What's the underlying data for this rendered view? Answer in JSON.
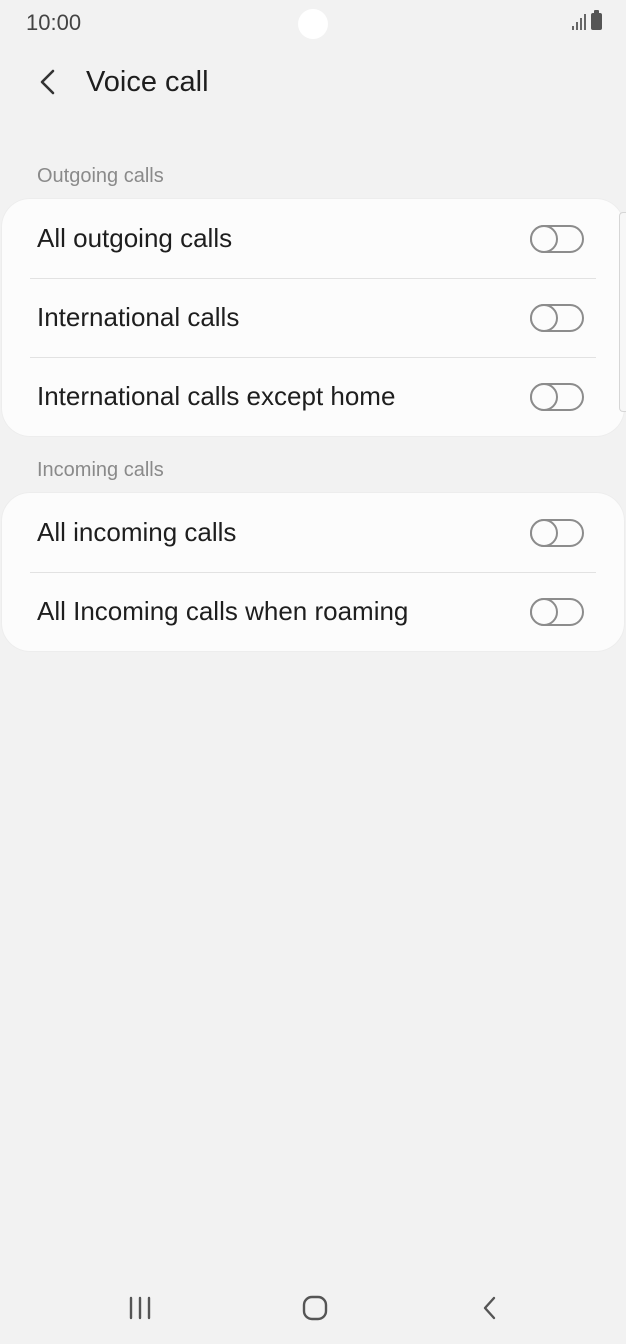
{
  "status_bar": {
    "time": "10:00"
  },
  "header": {
    "title": "Voice call",
    "back_icon": "chevron-left-icon"
  },
  "sections": [
    {
      "header": "Outgoing calls",
      "items": [
        {
          "label": "All outgoing calls",
          "enabled": false
        },
        {
          "label": "International calls",
          "enabled": false
        },
        {
          "label": "International calls except home",
          "enabled": false
        }
      ]
    },
    {
      "header": "Incoming calls",
      "items": [
        {
          "label": "All incoming calls",
          "enabled": false
        },
        {
          "label": "All Incoming calls when roaming",
          "enabled": false
        }
      ]
    }
  ],
  "nav_bar": {
    "recents_icon": "recents-icon",
    "home_icon": "home-icon",
    "back_icon": "back-icon"
  },
  "colors": {
    "background": "#f2f2f2",
    "card": "#fcfcfc",
    "toggle_off": "#8c8c8c",
    "section_header": "#8a8a8a"
  }
}
